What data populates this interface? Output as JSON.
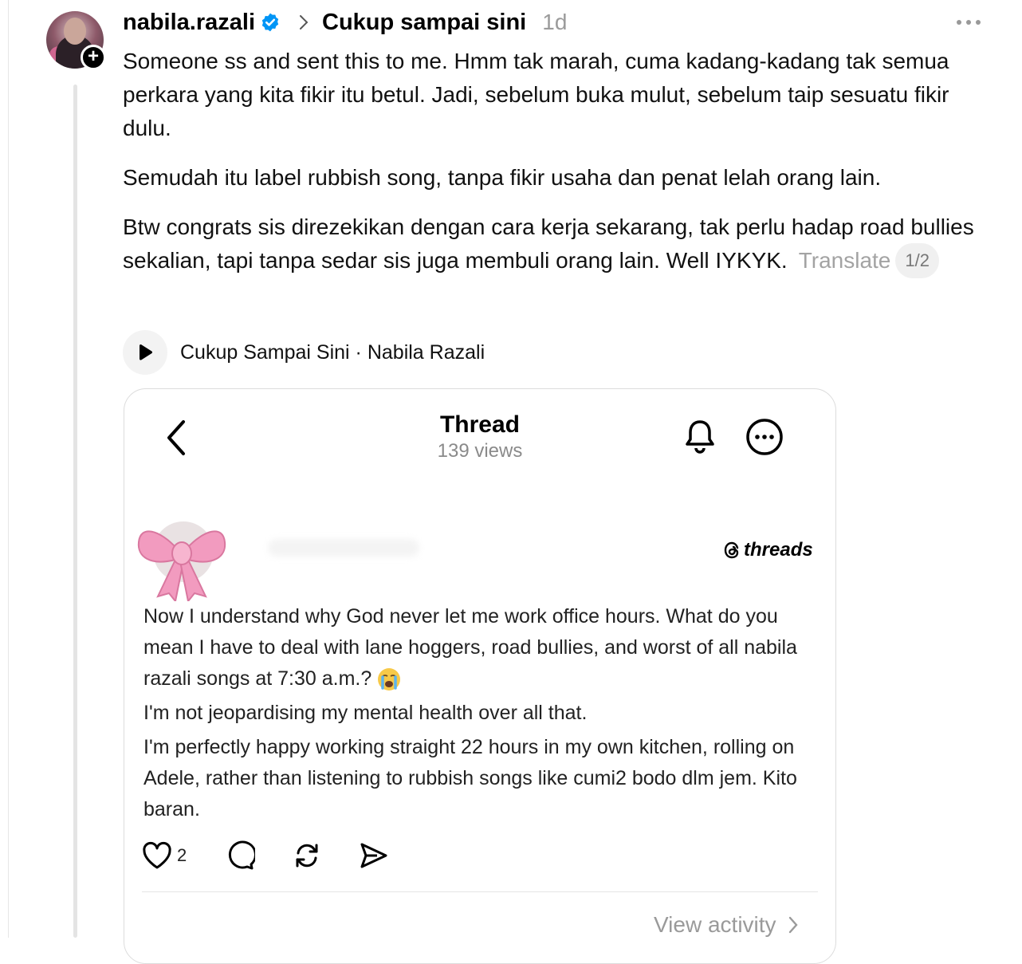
{
  "post": {
    "username": "nabila.razali",
    "topic": "Cukup sampai sini",
    "time": "1d",
    "paragraphs": [
      "Someone ss and sent this to me. Hmm tak marah, cuma kadang-kadang tak semua perkara yang kita fikir itu betul. Jadi, sebelum buka mulut, sebelum taip sesuatu fikir dulu.",
      "Semudah itu label rubbish song, tanpa fikir usaha dan penat lelah orang lain.",
      "Btw congrats sis direzekikan dengan cara kerja sekarang, tak perlu hadap road bullies sekalian, tapi tanpa sedar sis juga membuli orang lain. Well IYKYK."
    ],
    "translate_label": "Translate",
    "pager": "1/2",
    "music": "Cukup Sampai Sini · Nabila Razali"
  },
  "screenshot": {
    "title": "Thread",
    "views": "139 views",
    "logo_text": "threads",
    "lines": [
      "Now I understand why God never let me work office hours. What do you mean I have to deal with lane hoggers, road bullies, and worst of all nabila razali songs at 7:30 a.m.?",
      "I'm not jeopardising my mental health over all that.",
      "I'm perfectly happy working straight 22 hours in my own kitchen, rolling on Adele, rather than listening to rubbish songs like cumi2 bodo dlm jem. Kito baran."
    ],
    "like_count": "2",
    "view_activity": "View activity"
  },
  "icons": {
    "verified": "verified-badge-icon",
    "emoji": "loudly-crying-face"
  },
  "colors": {
    "verified_blue": "#0095f6",
    "muted_text": "#9b9b9b",
    "bow_pink": "#f29bbf"
  }
}
